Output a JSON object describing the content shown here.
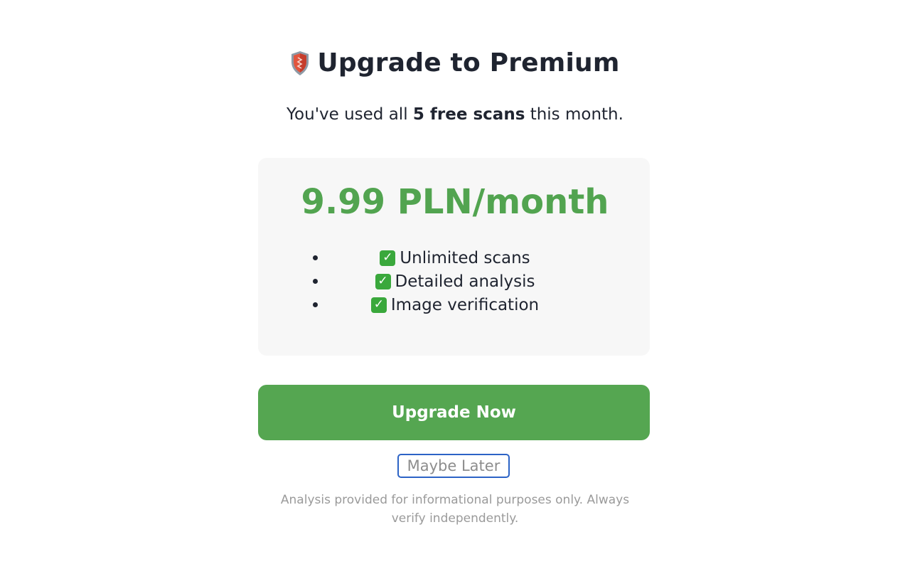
{
  "header": {
    "icon": "shield-icon",
    "title": "Upgrade to Premium"
  },
  "subtitle": {
    "prefix": "You've used all ",
    "highlight": "5 free scans",
    "suffix": " this month."
  },
  "pricing": {
    "price": "9.99 PLN/month",
    "accent_color": "#52a450",
    "features": [
      {
        "icon": "check-mark-icon",
        "label": "Unlimited scans"
      },
      {
        "icon": "check-mark-icon",
        "label": "Detailed analysis"
      },
      {
        "icon": "check-mark-icon",
        "label": "Image verification"
      }
    ]
  },
  "actions": {
    "upgrade_label": "Upgrade Now",
    "upgrade_color": "#55a651",
    "later_label": "Maybe Later",
    "focus_color": "#2c63c6"
  },
  "footer": {
    "disclaimer": "Analysis provided for informational purposes only. Always verify independently."
  }
}
